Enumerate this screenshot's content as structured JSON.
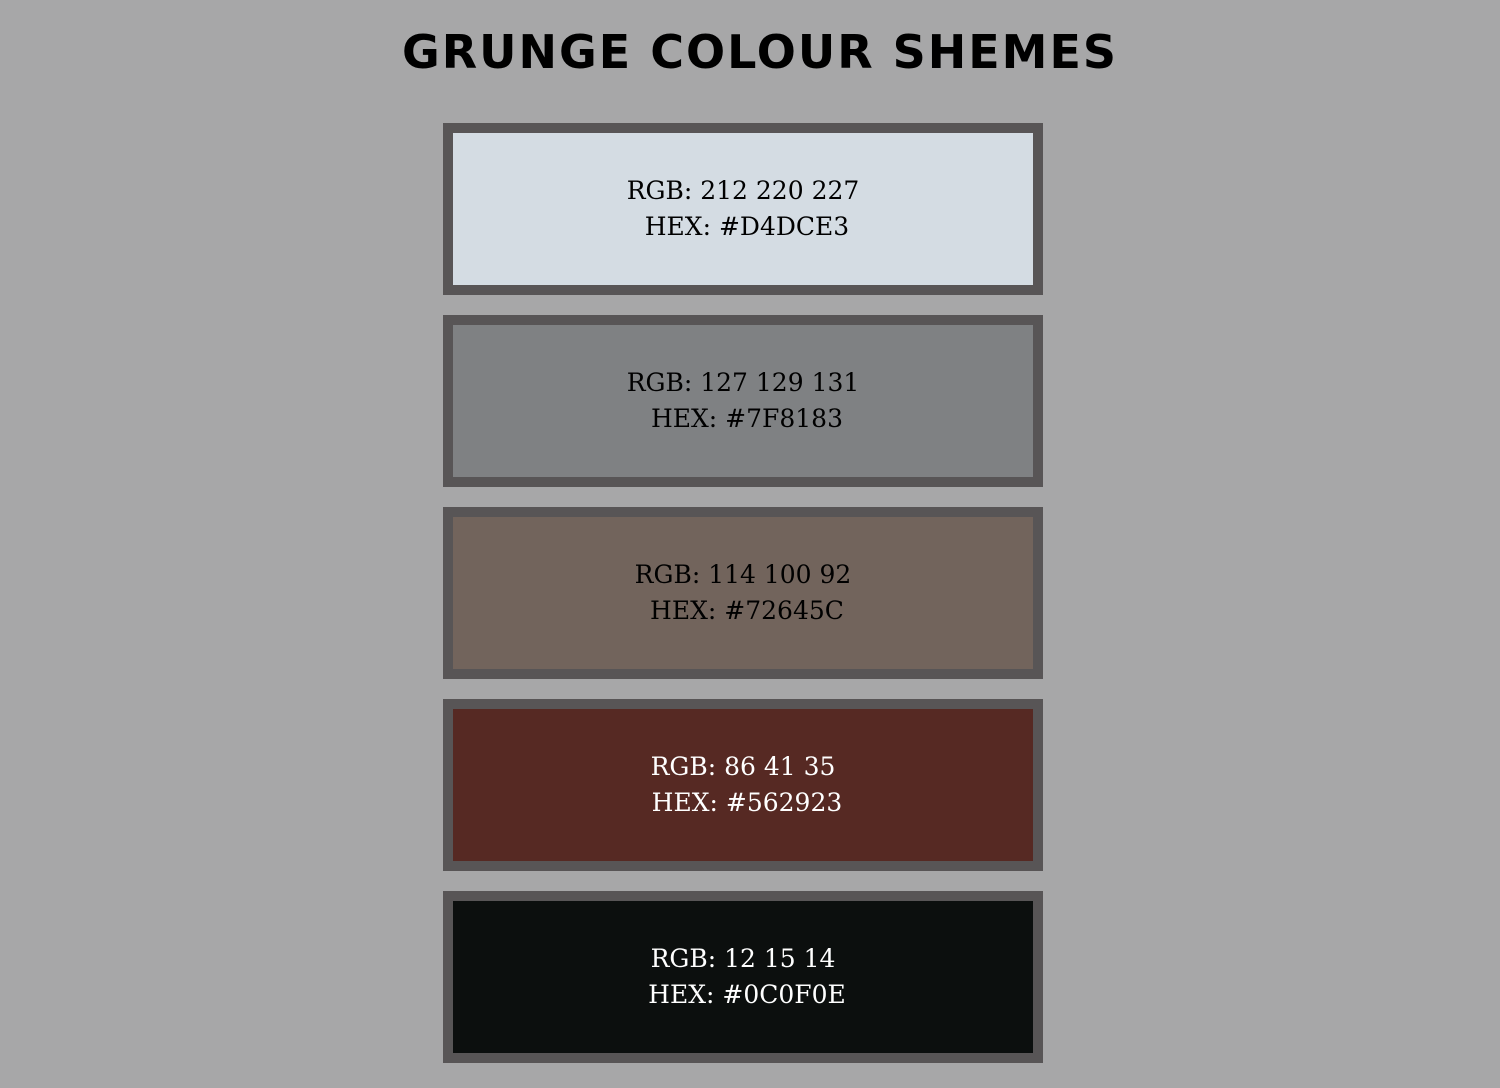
{
  "page": {
    "title": "GRUNGE COLOUR SHEMES",
    "background": "#A7A7A8",
    "swatch_border": "#585556"
  },
  "swatches": [
    {
      "rgb_label": "RGB: 212 220 227",
      "hex_label": " HEX: #D4DCE3",
      "color": "#D4DCE3",
      "text_color": "#000000"
    },
    {
      "rgb_label": "RGB: 127 129 131",
      "hex_label": " HEX: #7F8183",
      "color": "#7F8183",
      "text_color": "#000000"
    },
    {
      "rgb_label": "RGB: 114 100 92",
      "hex_label": " HEX: #72645C",
      "color": "#72645C",
      "text_color": "#000000"
    },
    {
      "rgb_label": "RGB: 86 41 35",
      "hex_label": " HEX: #562923",
      "color": "#562923",
      "text_color": "#FFFFFF"
    },
    {
      "rgb_label": "RGB: 12 15 14",
      "hex_label": " HEX: #0C0F0E",
      "color": "#0C0F0E",
      "text_color": "#FFFFFF"
    }
  ]
}
